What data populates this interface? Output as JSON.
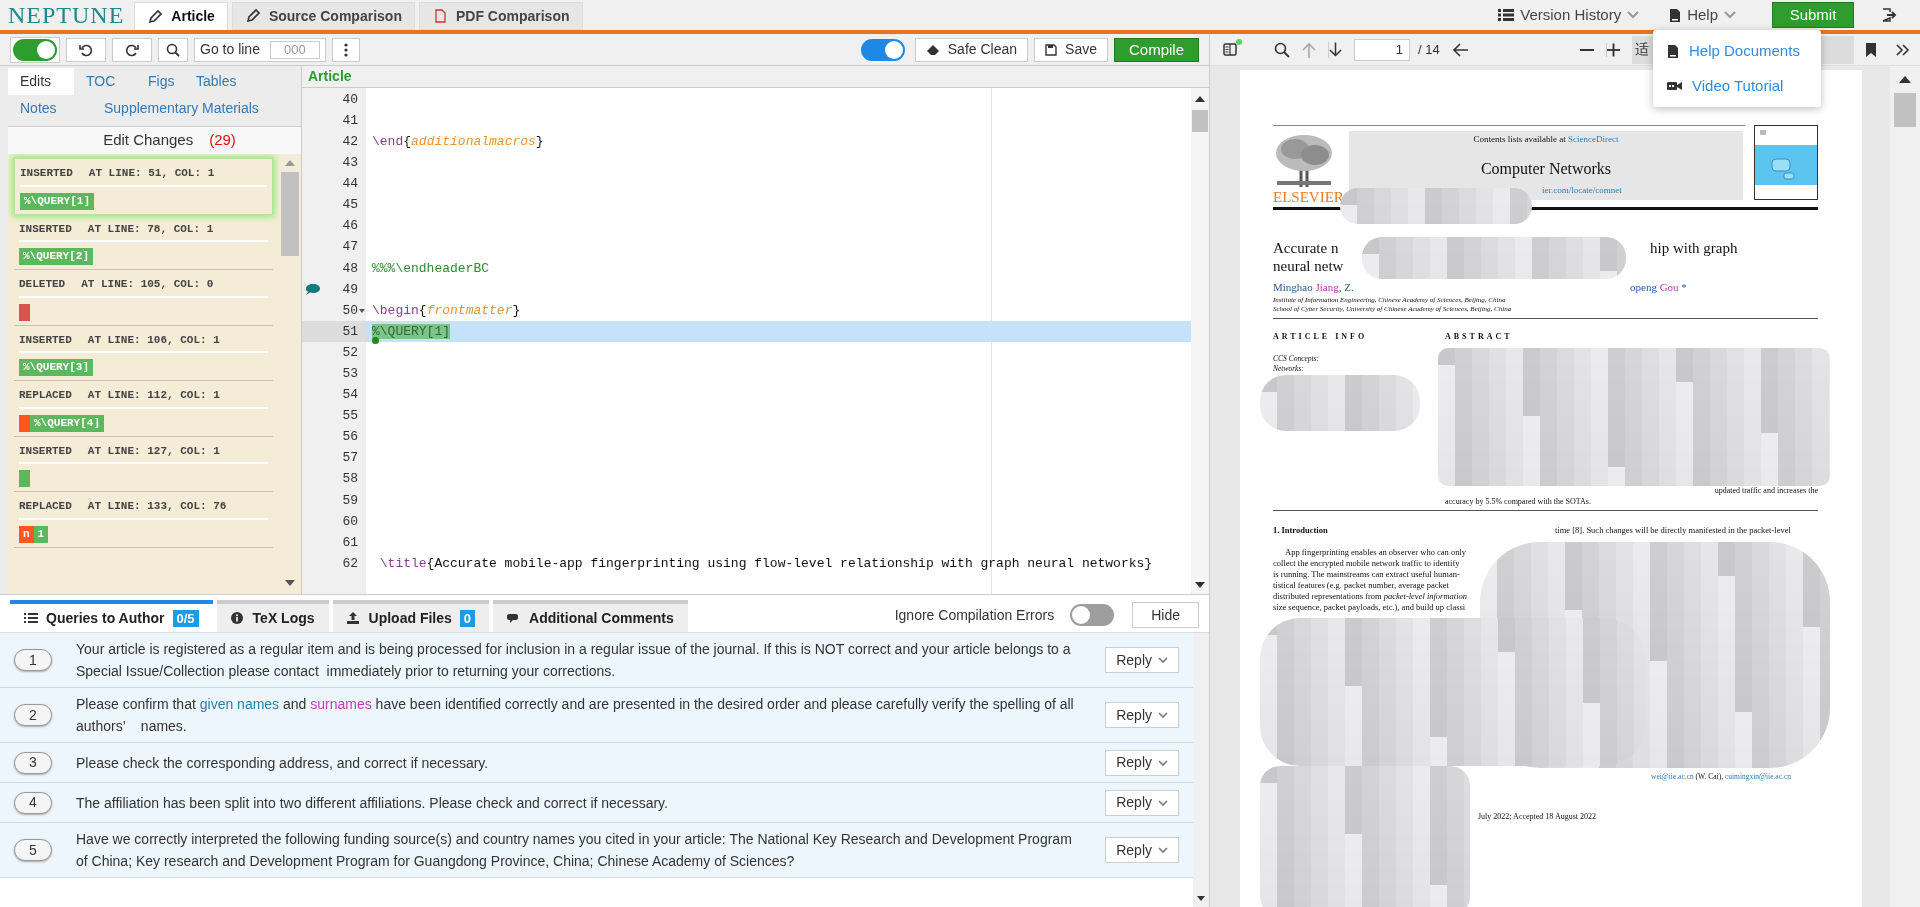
{
  "app": {
    "logo": "NEPTUNE",
    "tabs": [
      {
        "label": "Article",
        "selected": true
      },
      {
        "label": "Source Comparison",
        "selected": false
      },
      {
        "label": "PDF Comparison",
        "selected": false
      }
    ],
    "version_history": "Version History",
    "help": "Help",
    "submit": "Submit",
    "help_menu": {
      "expanded": true,
      "items": [
        "Help Documents",
        "Video Tutorial"
      ]
    }
  },
  "toolbar": {
    "track_toggle": {
      "on": true
    },
    "go_to_line": "Go to line",
    "line_placeholder": "000",
    "clean_toggle": {
      "on": true
    },
    "safe_clean": "Safe Clean",
    "save": "Save",
    "compile": "Compile"
  },
  "sidebar": {
    "tabs": [
      {
        "label": "Edits",
        "selected": true
      },
      {
        "label": "TOC",
        "selected": false
      },
      {
        "label": "Figs",
        "selected": false
      },
      {
        "label": "Tables",
        "selected": false
      },
      {
        "label": "Notes",
        "selected": false
      },
      {
        "label": "Supplementary Materials",
        "selected": false
      }
    ],
    "title": "Edit Changes",
    "count": "(29)",
    "edits": [
      {
        "action": "INSERTED",
        "position": "AT LINE: 51, COL: 1",
        "selected": true,
        "chips": [
          {
            "kind": "insert",
            "text": "%\\QUERY[1]"
          }
        ]
      },
      {
        "action": "INSERTED",
        "position": "AT LINE: 78, COL: 1",
        "selected": false,
        "chips": [
          {
            "kind": "insert",
            "text": "%\\QUERY[2]"
          }
        ]
      },
      {
        "action": "DELETED",
        "position": "AT LINE: 105, COL: 0",
        "selected": false,
        "chips": [
          {
            "kind": "delete"
          }
        ]
      },
      {
        "action": "INSERTED",
        "position": "AT LINE: 106, COL: 1",
        "selected": false,
        "chips": [
          {
            "kind": "insert",
            "text": "%\\QUERY[3]"
          }
        ]
      },
      {
        "action": "REPLACED",
        "position": "AT LINE: 112, COL: 1",
        "selected": false,
        "chips": [
          {
            "kind": "delete"
          },
          {
            "kind": "insert",
            "text": "%\\QUERY[4]"
          }
        ]
      },
      {
        "action": "INSERTED",
        "position": "AT LINE: 127, COL: 1",
        "selected": false,
        "chips": [
          {
            "kind": "insert"
          }
        ]
      },
      {
        "action": "REPLACED",
        "position": "AT LINE: 133, COL: 76",
        "selected": false,
        "chips": [
          {
            "kind": "delete",
            "text": "n"
          },
          {
            "kind": "insert",
            "text": "1"
          }
        ]
      }
    ]
  },
  "editor": {
    "title": "Article",
    "lines": [
      {
        "n": "40",
        "kind": "plain",
        "selected": false
      },
      {
        "n": "41",
        "kind": "plain",
        "selected": false
      },
      {
        "n": "42",
        "kind": "plain",
        "selected": false,
        "tokens": [
          {
            "kind": "command",
            "text": "\\end"
          },
          {
            "kind": "text",
            "text": "{"
          },
          {
            "kind": "argument",
            "text": "additionalmacros"
          },
          {
            "kind": "text",
            "text": "}"
          }
        ]
      },
      {
        "n": "43",
        "kind": "plain",
        "selected": false
      },
      {
        "n": "44",
        "kind": "plain",
        "selected": false
      },
      {
        "n": "45",
        "kind": "plain",
        "selected": false
      },
      {
        "n": "46",
        "kind": "plain",
        "selected": false
      },
      {
        "n": "47",
        "kind": "plain",
        "selected": false
      },
      {
        "n": "48",
        "kind": "plain",
        "selected": false,
        "tokens": [
          {
            "kind": "comment",
            "text": "%%%\\endheaderBC"
          }
        ]
      },
      {
        "n": "49",
        "kind": "note",
        "selected": false
      },
      {
        "n": "50",
        "kind": "fold",
        "selected": false,
        "tokens": [
          {
            "kind": "command",
            "text": "\\begin"
          },
          {
            "kind": "text",
            "text": "{"
          },
          {
            "kind": "argument",
            "text": "frontmatter"
          },
          {
            "kind": "text",
            "text": "}"
          }
        ]
      },
      {
        "n": "51",
        "kind": "plain",
        "selected": true,
        "tokens": [
          {
            "kind": "query",
            "text": "%\\QUERY[1]"
          }
        ]
      },
      {
        "n": "52",
        "kind": "plain",
        "selected": false
      },
      {
        "n": "53",
        "kind": "plain",
        "selected": false
      },
      {
        "n": "54",
        "kind": "plain",
        "selected": false
      },
      {
        "n": "55",
        "kind": "plain",
        "selected": false
      },
      {
        "n": "56",
        "kind": "plain",
        "selected": false
      },
      {
        "n": "57",
        "kind": "plain",
        "selected": false
      },
      {
        "n": "58",
        "kind": "plain",
        "selected": false
      },
      {
        "n": "59",
        "kind": "plain",
        "selected": false
      },
      {
        "n": "60",
        "kind": "plain",
        "selected": false
      },
      {
        "n": "61",
        "kind": "plain",
        "selected": false
      },
      {
        "n": "62",
        "kind": "plain",
        "selected": false,
        "tokens": [
          {
            "kind": "command",
            "text": " \\title"
          },
          {
            "kind": "text",
            "text": "{Accurate mobile-app fingerprinting using flow-level relationship with graph neural networks}"
          }
        ]
      }
    ]
  },
  "bottom": {
    "tabs": [
      {
        "label": "Queries to Author",
        "badge": "0/5",
        "selected": true
      },
      {
        "label": "TeX Logs",
        "selected": false
      },
      {
        "label": "Upload Files",
        "badge": "0",
        "selected": false
      },
      {
        "label": "Additional Comments",
        "selected": false
      }
    ],
    "ignore_errors": {
      "label": "Ignore Compilation Errors",
      "on": false
    },
    "hide": "Hide",
    "queries": [
      {
        "number": "1",
        "reply": "Reply",
        "segments": [
          {
            "kind": "plain",
            "text": "Your article is registered as a regular item and is being processed for inclusion in a regular issue of the journal. If this is NOT correct and your article belongs to a Special Issue/Collection please contact  immediately prior to returning your corrections."
          }
        ]
      },
      {
        "number": "2",
        "reply": "Reply",
        "segments": [
          {
            "kind": "plain",
            "text": "Please confirm that "
          },
          {
            "kind": "given-name",
            "text": "given names"
          },
          {
            "kind": "plain",
            "text": " and "
          },
          {
            "kind": "surname",
            "text": "surnames"
          },
          {
            "kind": "plain",
            "text": " have been identified correctly and are presented in the desired order and please carefully verify the spelling of all authors’    names."
          }
        ]
      },
      {
        "number": "3",
        "reply": "Reply",
        "segments": [
          {
            "kind": "plain",
            "text": "Please check the corresponding address, and correct if necessary."
          }
        ]
      },
      {
        "number": "4",
        "reply": "Reply",
        "segments": [
          {
            "kind": "plain",
            "text": "The affiliation has been split into two different affiliations. Please check and correct if necessary."
          }
        ]
      },
      {
        "number": "5",
        "reply": "Reply",
        "segments": [
          {
            "kind": "plain",
            "text": "Have we correctly interpreted the following funding source(s) and country names you cited in your article: The National Key Research and Development Program of China; Key research and Development Program for Guangdong Province, China; Chinese Academy of Sciences?"
          }
        ]
      }
    ]
  },
  "pdf_viewer": {
    "page": "1",
    "total": "/ 14",
    "zoom_label": "适",
    "document": {
      "contents_note": [
        {
          "kind": "plain",
          "text": "Contents lists available at "
        },
        {
          "kind": "link",
          "text": "ScienceDirect"
        }
      ],
      "journal": "Computer Networks",
      "url_fragment": "ier.com/locate/comnet",
      "publisher": "ELSEVIER",
      "title_fragments": [
        "Accurate n",
        "hip with graph",
        "neural netw"
      ],
      "author_fragments": [
        [
          {
            "kind": "plain",
            "text": "Minghao "
          },
          {
            "kind": "surname",
            "text": "Jiang"
          },
          {
            "kind": "plain",
            "text": ", Z."
          }
        ],
        [
          {
            "kind": "plain",
            "text": "openg "
          },
          {
            "kind": "surname",
            "text": "Gou"
          },
          {
            "kind": "plain",
            "text": " *"
          }
        ]
      ],
      "affiliations": [
        "Institute of Information Engineering, Chinese Academy of Sciences, Beijing, China",
        "School of Cyber Security, University of Chinese Academy of Sciences, Beijing, China"
      ],
      "article_info_heading": "ARTICLE INFO",
      "abstract_heading": "ABSTRACT",
      "keyword_fragments": [
        "CCS Concepts:",
        "Networks:"
      ],
      "abstract_fragments": [
        "updated traffic and increases the",
        "accuracy by 5.5% compared with the SOTAs."
      ],
      "intro_heading": "1. Introduction",
      "intro_left": [
        "App fingerprinting enables an observer who can only",
        "collect the encrypted mobile network traffic to identify",
        "is running. The mainstreams can extract useful human-",
        "tistical features (e.g. packet number, average packet",
        "distributed representations from *packet-level information*",
        "size sequence, packet payloads, etc.), and build up classi"
      ],
      "intro_right": [
        "time [8]. Such changes will be directly manifested in the packet-level"
      ],
      "email_fragment": [
        {
          "kind": "link",
          "text": "wei@iie.ac.cn"
        },
        {
          "kind": "plain",
          "text": " (W. Cai), "
        },
        {
          "kind": "link",
          "text": "cuimingxin@iie.ac.cn"
        }
      ],
      "dates_fragment": "July 2022; Accepted 18 August 2022"
    }
  }
}
